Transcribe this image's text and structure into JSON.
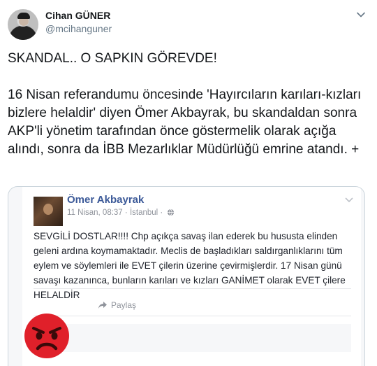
{
  "tweet": {
    "display_name": "Cihan GÜNER",
    "handle": "@mcihanguner",
    "headline": "SKANDAL.. O SAPKIN GÖREVDE!",
    "body": "16 Nisan referandumu öncesinde 'Hayırcıların karıları-kızları bizlere helaldir' diyen Ömer Akbayrak, bu skandaldan sonra AKP'li yönetim tarafından önce göstermelik olarak açığa alındı, sonra da İBB Mezarlıklar Müdürlüğü emrine atandı. +"
  },
  "embedded_post": {
    "author": "Ömer Akbayrak",
    "date": "11 Nisan, 08:37",
    "location": "İstanbul",
    "text": "SEVGİLİ DOSTLAR!!!! Chp açıkça savaş ilan ederek bu hususta elinden geleni ardına koymamaktadır. Meclis de başladıkları saldırganlıklarını tüm eylem ve söylemleri ile EVET çilerin üzerine çevirmişlerdir. 17 Nisan günü savaşı kazanınca, bunların karıları ve kızları GANİMET olarak EVET çilere HELALDİR",
    "share_label": "Paylaş"
  },
  "icons": {
    "menu": "chevron-down-icon",
    "globe": "globe-icon",
    "share": "share-arrow-icon",
    "reaction": "angry-face-icon"
  },
  "colors": {
    "text": "#14171a",
    "muted": "#657786",
    "fb_blue": "#3b5998",
    "angry_red": "#e0202a"
  }
}
